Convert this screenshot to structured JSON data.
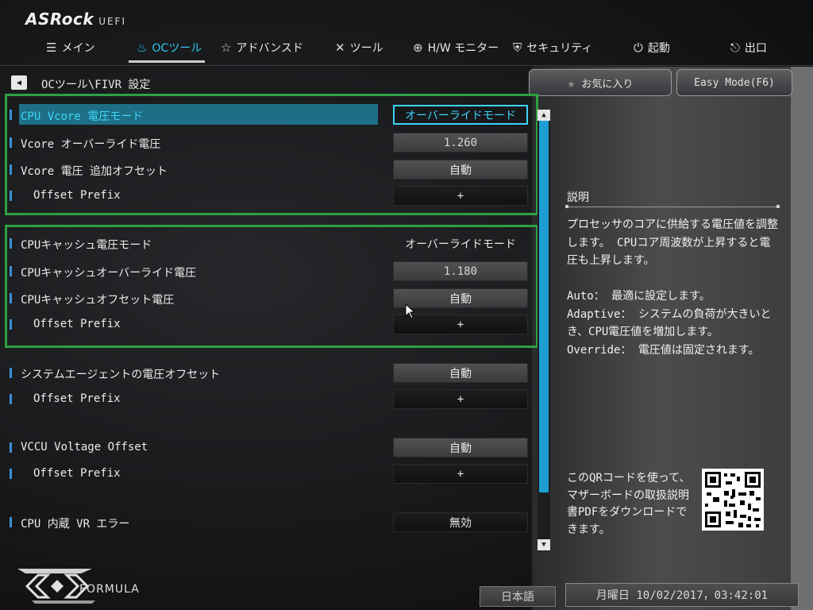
{
  "header": {
    "logo": "ASRock",
    "logo_suffix": "UEFI",
    "tabs": [
      {
        "label": "メイン",
        "icon": "list-icon"
      },
      {
        "label": "OCツール",
        "icon": "flame-icon"
      },
      {
        "label": "アドバンスド",
        "icon": "star-icon"
      },
      {
        "label": "ツール",
        "icon": "wrench-icon"
      },
      {
        "label": "H/W モニター",
        "icon": "crosshair-icon"
      },
      {
        "label": "セキュリティ",
        "icon": "shield-icon"
      },
      {
        "label": "起動",
        "icon": "power-icon"
      },
      {
        "label": "出口",
        "icon": "exit-icon"
      }
    ],
    "active_tab": "OCツール"
  },
  "breadcrumb": "OCツール\\FIVR 設定",
  "toolbar": {
    "favorites": "お気に入り",
    "easy_mode": "Easy Mode(F6)"
  },
  "settings": [
    {
      "label": "CPU Vcore 電圧モード",
      "value": "オーバーライドモード"
    },
    {
      "label": "Vcore オーバーライド電圧",
      "value": "1.260"
    },
    {
      "label": "Vcore 電圧 追加オフセット",
      "value": "自動"
    },
    {
      "label": "Offset Prefix",
      "value": "+"
    },
    {
      "label": "CPUキャッシュ電圧モード",
      "value": "オーバーライドモード"
    },
    {
      "label": "CPUキャッシュオーバーライド電圧",
      "value": "1.180"
    },
    {
      "label": "CPUキャッシュオフセット電圧",
      "value": "自動"
    },
    {
      "label": "Offset Prefix",
      "value": "+"
    },
    {
      "label": "システムエージェントの電圧オフセット",
      "value": "自動"
    },
    {
      "label": "Offset Prefix",
      "value": "+"
    },
    {
      "label": "VCCU Voltage Offset",
      "value": "自動"
    },
    {
      "label": "Offset Prefix",
      "value": "+"
    },
    {
      "label": "CPU 内蔵 VR エラー",
      "value": "無効"
    }
  ],
  "description": {
    "title": "説明",
    "body": "プロセッサのコアに供給する電圧値を調整します。 CPUコア周波数が上昇すると電圧も上昇します。\n\nAuto： 最適に設定します。\nAdaptive： システムの負荷が大きいとき、CPU電圧値を増加します。\nOverride： 電圧値は固定されます。",
    "qr_text": "このQRコードを使って、マザーボードの取扱説明書PDFをダウンロードできます。"
  },
  "footer": {
    "brand": "FORMULA",
    "language": "日本語",
    "datetime": "月曜日 10/02/2017，03:42:01"
  },
  "colors": {
    "accent": "#31c6f2",
    "highlight": "#1e6f86",
    "group_border": "#2ea043",
    "scrollbar": "#1e9fd4"
  }
}
